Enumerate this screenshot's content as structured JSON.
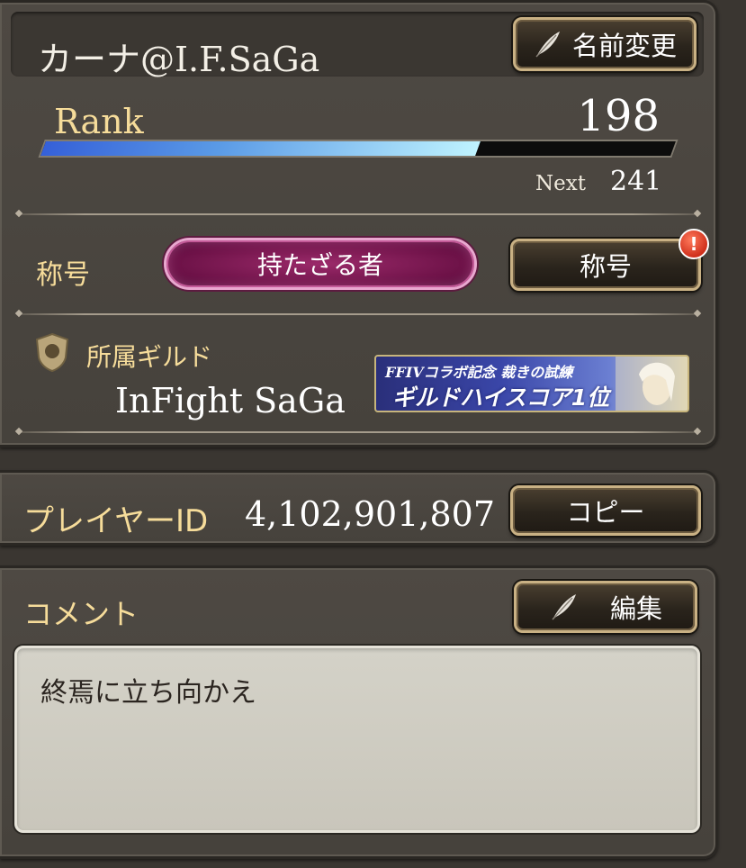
{
  "profile": {
    "player_name": "カーナ@I.F.SaGa",
    "rename_button": "名前変更",
    "rank_label": "Rank",
    "rank_value": "198",
    "rank_progress": 0.69,
    "next_label": "Next",
    "next_value": "241",
    "title_label": "称号",
    "title_value": "持たざる者",
    "title_button": "称号",
    "title_badge": "!",
    "guild_label": "所属ギルド",
    "guild_name": "InFight SaGa",
    "guild_banner_line1": "FFIVコラボ記念 裁きの試練",
    "guild_banner_line2": "ギルドハイスコア1位"
  },
  "player_id": {
    "label": "プレイヤーID",
    "value": "4,102,901,807",
    "copy_button": "コピー"
  },
  "comment": {
    "label": "コメント",
    "edit_button": "編集",
    "text": "終焉に立ち向かえ"
  },
  "colors": {
    "label_gold": "#f6dc9a",
    "panel": "#4b4640",
    "button_border": "#c9b184",
    "title_plate": "#8a1f5c"
  }
}
